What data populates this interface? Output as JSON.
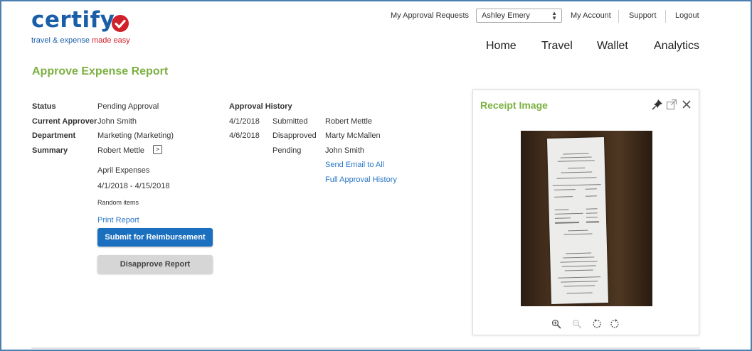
{
  "brand": {
    "name": "certify",
    "tagline_part1": "travel & expense",
    "tagline_part2": " made easy",
    "colors": {
      "blue": "#1a5ea8",
      "red": "#d0212b",
      "green": "#7cb041",
      "button_blue": "#1a6fbf"
    }
  },
  "header": {
    "my_approval_requests": "My Approval Requests",
    "user_select": {
      "value": "Ashley Emery"
    },
    "my_account": "My Account",
    "support": "Support",
    "logout": "Logout",
    "nav": [
      "Home",
      "Travel",
      "Wallet",
      "Analytics"
    ]
  },
  "page_title": "Approve Expense Report",
  "details": {
    "status_label": "Status",
    "status_value": "Pending Approval",
    "approver_label": "Current Approver",
    "approver_value": "John Smith",
    "department_label": "Department",
    "department_value": "Marketing (Marketing)",
    "summary_label": "Summary",
    "summary_value": "Robert Mettle",
    "report_name": "April Expenses",
    "report_dates": "4/1/2018 - 4/15/2018",
    "report_note": "Random items",
    "print_report": "Print Report"
  },
  "buttons": {
    "submit": "Submit for Reimbursement",
    "disapprove": "Disapprove Report"
  },
  "approval_history": {
    "title": "Approval History",
    "rows": [
      {
        "date": "4/1/2018",
        "action": "Submitted",
        "person": "Robert Mettle"
      },
      {
        "date": "4/6/2018",
        "action": "Disapproved",
        "person": "Marty McMallen"
      },
      {
        "date": "",
        "action": "Pending",
        "person": "John Smith"
      }
    ],
    "send_email": "Send Email to All",
    "full_history": "Full Approval History"
  },
  "receipt_panel": {
    "title": "Receipt Image",
    "header_icons": [
      "pin-icon",
      "external-link-icon",
      "close-icon"
    ],
    "toolbar_icons": [
      "zoom-in-icon",
      "zoom-out-icon",
      "rotate-left-icon",
      "rotate-right-icon"
    ]
  }
}
